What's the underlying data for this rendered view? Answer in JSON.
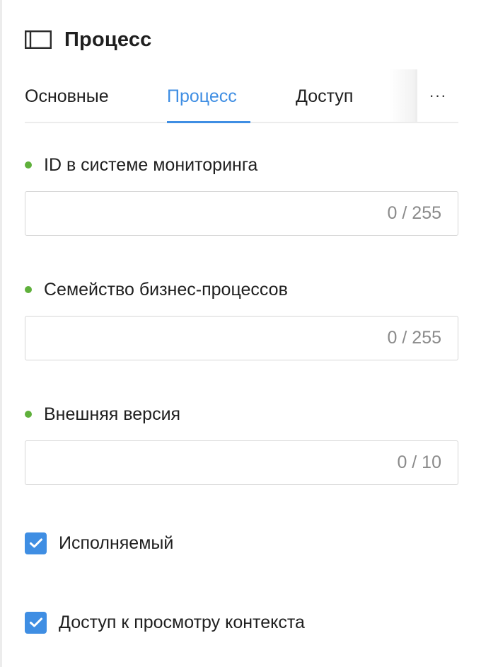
{
  "header": {
    "icon": "panel-icon",
    "title": "Процесс"
  },
  "tabs": {
    "items": [
      {
        "label": "Основные",
        "active": false
      },
      {
        "label": "Процесс",
        "active": true
      },
      {
        "label": "Доступ",
        "active": false
      }
    ],
    "more_label": "···",
    "accent_color": "#3f8ee3"
  },
  "fields": [
    {
      "label": "ID в системе мониторинга",
      "value": "",
      "counter": "0 / 255",
      "indicator_color": "#5fb03b"
    },
    {
      "label": "Семейство бизнес-процессов",
      "value": "",
      "counter": "0 / 255",
      "indicator_color": "#5fb03b"
    },
    {
      "label": "Внешняя версия",
      "value": "",
      "counter": "0 / 10",
      "indicator_color": "#5fb03b"
    }
  ],
  "checkboxes": [
    {
      "label": "Исполняемый",
      "checked": true
    },
    {
      "label": "Доступ к просмотру контекста",
      "checked": true
    }
  ]
}
